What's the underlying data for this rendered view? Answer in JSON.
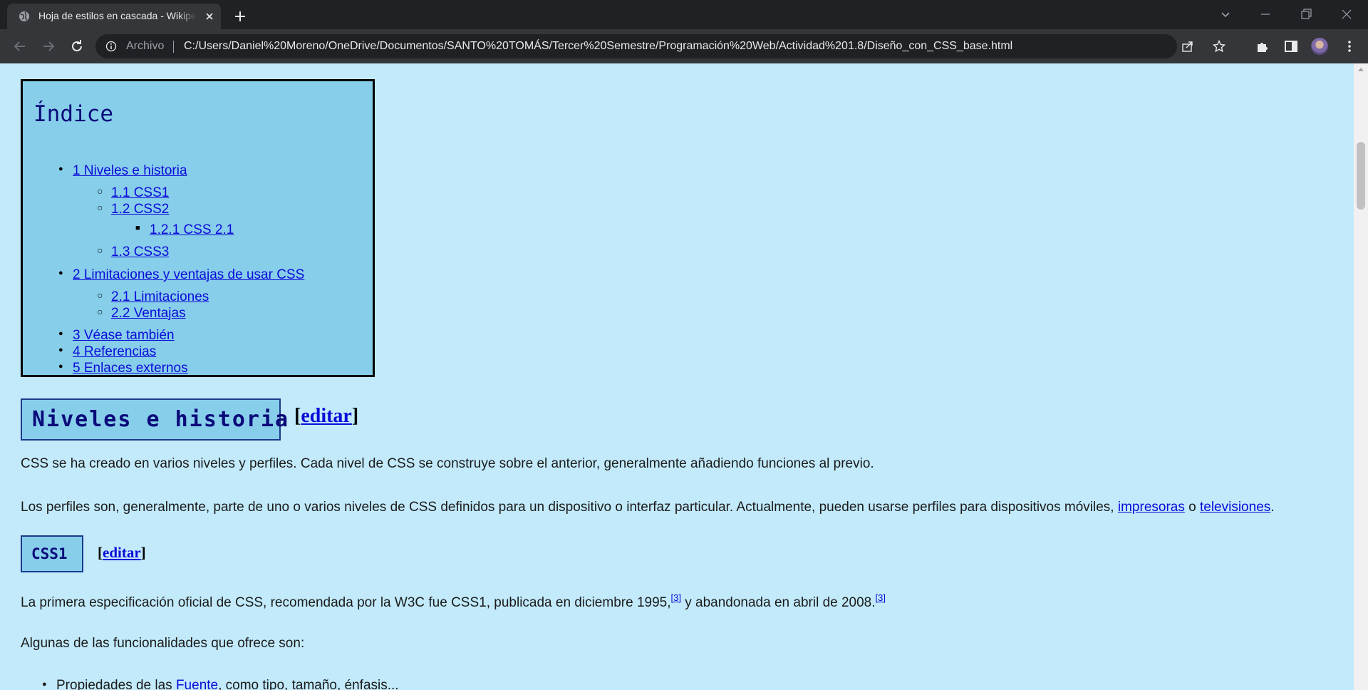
{
  "browser": {
    "tab_title": "Hoja de estilos en cascada - Wikipedia",
    "url_scheme": "Archivo",
    "url": "C:/Users/Daniel%20Moreno/OneDrive/Documentos/SANTO%20TOMÁS/Tercer%20Semestre/Programación%20Web/Actividad%201.8/Diseño_con_CSS_base.html"
  },
  "toc": {
    "title": "Índice",
    "items": [
      {
        "label": "1 Niveles e historia"
      },
      {
        "label": "1.1 CSS1"
      },
      {
        "label": "1.2 CSS2"
      },
      {
        "label": "1.2.1 CSS 2.1"
      },
      {
        "label": "1.3 CSS3"
      },
      {
        "label": "2 Limitaciones y ventajas de usar CSS"
      },
      {
        "label": "2.1 Limitaciones"
      },
      {
        "label": "2.2 Ventajas"
      },
      {
        "label": "3 Véase también"
      },
      {
        "label": "4 Referencias"
      },
      {
        "label": "5 Enlaces externos"
      }
    ]
  },
  "section1": {
    "heading": "Niveles e historia",
    "edit_open": "[",
    "edit_label": "editar",
    "edit_close": "]",
    "para1": "CSS se ha creado en varios niveles y perfiles. Cada nivel de CSS se construye sobre el anterior, generalmente añadiendo funciones al previo.",
    "para2_text": "Los perfiles son, generalmente, parte de uno o varios niveles de CSS definidos para un dispositivo o interfaz particular. Actualmente, pueden usarse perfiles para dispositivos móviles, ",
    "para2_link1": "impresoras",
    "para2_mid": " o ",
    "para2_link2": "televisiones",
    "para2_end": "."
  },
  "section2": {
    "heading": "CSS1",
    "edit_label": "editar",
    "para1_a": "La primera especificación oficial de CSS, recomendada por la W3C fue CSS1, publicada en diciembre 1995,",
    "ref1": "[3]",
    "para1_b": " y abandonada en abril de 2008.",
    "ref2": "[3]",
    "para2": "Algunas de las funcionalidades que ofrece son:",
    "bullet1_a": "Propiedades de las ",
    "bullet1_link": "Fuente",
    "bullet1_b": ", como tipo, tamaño, énfasis..."
  }
}
